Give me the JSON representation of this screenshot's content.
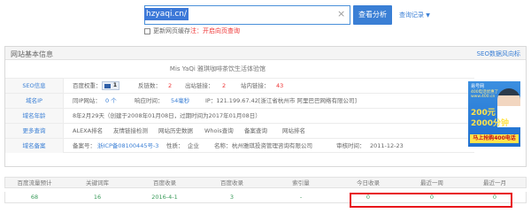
{
  "search": {
    "query": "hzyaqi.cn/",
    "clear_icon": "×",
    "button": "查看分析",
    "history": "查询记录",
    "history_arrow": "▼",
    "update_label": "更新网页缓存",
    "update_note": "注：开启向页查询"
  },
  "panel": {
    "title": "网站基本信息",
    "link": "SEO数据风向标",
    "site_title": "Mis YaQi 雅琪咖啡茶饮生活体验馆"
  },
  "rows": {
    "seo": {
      "label": "SEO信息",
      "baidu_weight_label": "百度权重：",
      "baidu_weight_value": "1",
      "backlinks_label": "反链数：",
      "backlinks_value": "2",
      "outbound_label": "出站链接：",
      "outbound_value": "2",
      "internal_label": "站内链接：",
      "internal_value": "43"
    },
    "ip": {
      "label": "域名IP",
      "same_ip_label": "同IP网站：",
      "same_ip_value": "0 个",
      "response_label": "响应时间：",
      "response_value": "54毫秒",
      "ip_text": "IP：121.199.67.42[浙江省杭州市 阿里巴巴网络有限公司]"
    },
    "age": {
      "label": "域名年龄",
      "text": "8年2月29天（创建于2008年01月08日，过期时间为2017年01月08日）"
    },
    "more": {
      "label": "更多查询",
      "links": [
        "ALEXA排名",
        "友情链接检测",
        "网站历史数据",
        "Whois查询",
        "备案查询",
        "网站排名"
      ]
    },
    "icp": {
      "label": "域名备案",
      "license_label": "备案号：",
      "license_value": "浙ICP备08100445号-3",
      "nature_label": "性质：",
      "nature_value": "企业",
      "name_label": "名称：",
      "name_value": "杭州雅琪投资管理咨询有限公司",
      "date_label": "审核时间：",
      "date_value": "2011-12-23"
    }
  },
  "ad": {
    "line1": "易号网",
    "line2": "400电话优惠了 www.400.cn",
    "line3": "200元",
    "line4": "2000分钟",
    "line5": "马上抢购400电话"
  },
  "stats": {
    "headers": [
      "百度流量预计",
      "关键词库",
      "百度收录",
      "百度收录",
      "索引量",
      "今日收录",
      "最近一周",
      "最近一月"
    ],
    "values": [
      "68",
      "16",
      "2016-4-1",
      "3",
      "-",
      "0",
      "0",
      "0"
    ]
  }
}
